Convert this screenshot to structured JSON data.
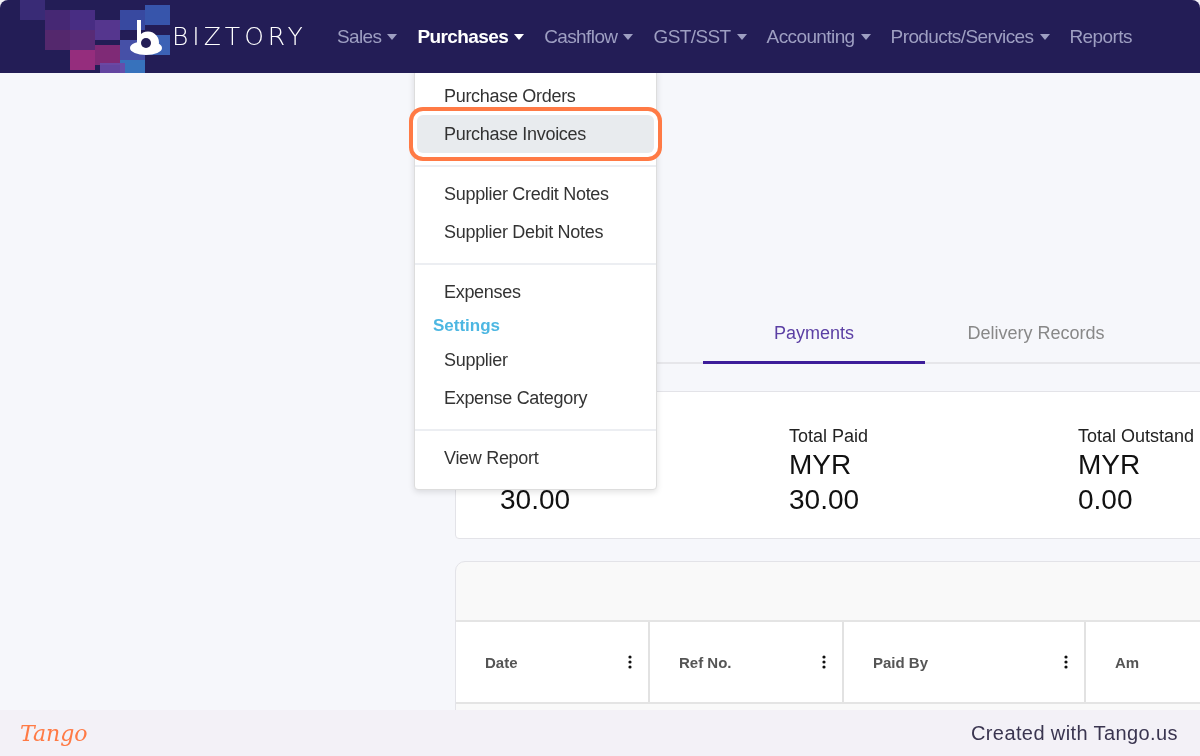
{
  "nav": {
    "brand": "BIZTORY",
    "menus": [
      {
        "label": "Sales",
        "selected": false
      },
      {
        "label": "Purchases",
        "selected": true
      },
      {
        "label": "Cashflow",
        "selected": false
      },
      {
        "label": "GST/SST",
        "selected": false
      },
      {
        "label": "Accounting",
        "selected": false
      },
      {
        "label": "Products/Services",
        "selected": false
      },
      {
        "label": "Reports",
        "selected": false,
        "caret": false
      }
    ]
  },
  "dropdown": {
    "sections": [
      {
        "items": [
          {
            "kind": "link",
            "label": "Purchase Orders",
            "selected": false
          },
          {
            "kind": "link",
            "label": "Purchase Invoices",
            "selected": true
          }
        ]
      },
      {
        "items": [
          {
            "kind": "link",
            "label": "Supplier Credit Notes",
            "selected": false
          },
          {
            "kind": "link",
            "label": "Supplier Debit Notes",
            "selected": false
          }
        ]
      },
      {
        "items": [
          {
            "kind": "link",
            "label": "Expenses",
            "selected": false
          },
          {
            "kind": "heading",
            "label": "Settings"
          },
          {
            "kind": "link",
            "label": "Supplier",
            "selected": false
          },
          {
            "kind": "link",
            "label": "Expense Category",
            "selected": false
          }
        ]
      },
      {
        "items": [
          {
            "kind": "link",
            "label": "View Report",
            "selected": false
          }
        ]
      }
    ]
  },
  "tabs": [
    {
      "label": "Payments",
      "selected": true
    },
    {
      "label": "Delivery Records",
      "selected": false
    }
  ],
  "summary": [
    {
      "amount": "30.00"
    },
    {
      "label": "Total Paid",
      "currency": "MYR",
      "amount": "30.00"
    },
    {
      "label": "Total Outstand",
      "currency": "MYR",
      "amount": "0.00"
    }
  ],
  "table": {
    "columns": [
      {
        "label": "Date",
        "menu": true
      },
      {
        "label": "Ref No.",
        "menu": true
      },
      {
        "label": "Paid By",
        "menu": true
      },
      {
        "label": "Am"
      }
    ]
  },
  "footer": {
    "logo": "Tango",
    "credit": "Created with Tango.us"
  }
}
